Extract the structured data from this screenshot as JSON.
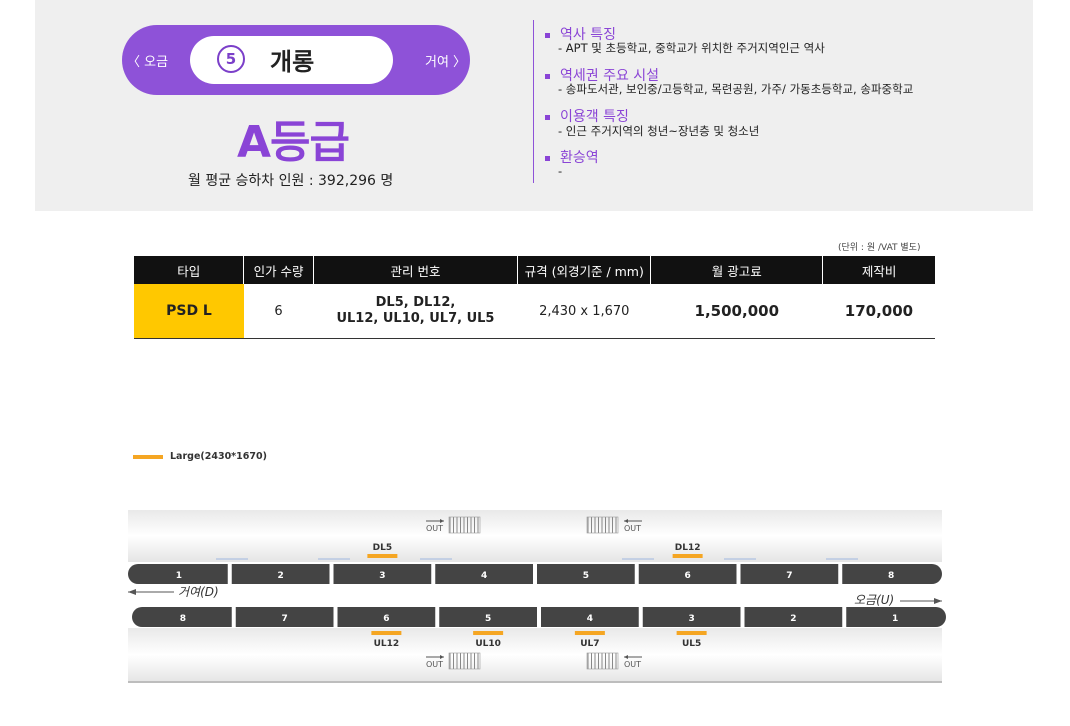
{
  "station": {
    "prev_label": "〈 오금",
    "next_label": "거여 〉",
    "line_number": "5",
    "name": "개롱",
    "grade": "A등급",
    "ridership_label": "월 평균 승하차 인원 :",
    "ridership_value": "392,296 명"
  },
  "features": [
    {
      "title": "역사 특징",
      "desc": "-  APT 및 초등학교, 중학교가 위치한 주거지역인근 역사"
    },
    {
      "title": "역세권 주요 시설",
      "desc": "-  송파도서관, 보인중/고등학교, 목련공원, 가주/ 가동초등학교, 송파중학교"
    },
    {
      "title": "이용객 특징",
      "desc": "-  인근 주거지역의 청년~장년층 및 청소년"
    },
    {
      "title": "환승역",
      "desc": "-"
    }
  ],
  "table": {
    "unit_note": "(단위 : 원 /VAT 별도)",
    "headers": [
      "타입",
      "인가 수량",
      "관리 번호",
      "규격 (외경기준 / mm)",
      "월 광고료",
      "제작비"
    ],
    "row": {
      "type": "PSD L",
      "quantity": "6",
      "mgmt_line1": "DL5, DL12,",
      "mgmt_line2": "UL12, UL10, UL7, UL5",
      "size": "2,430 x 1,670",
      "monthly_fee": "1,500,000",
      "production_fee": "170,000"
    }
  },
  "legend": {
    "label": "Large(2430*1670)",
    "color": "#f5a623"
  },
  "diagram": {
    "top_doors": [
      "1",
      "2",
      "3",
      "4",
      "5",
      "6",
      "7",
      "8"
    ],
    "bottom_doors": [
      "8",
      "7",
      "6",
      "5",
      "4",
      "3",
      "2",
      "1"
    ],
    "direction_left": "거여(D)",
    "direction_right": "오금(U)",
    "exit_label": "OUT",
    "top_ads": [
      "DL5",
      "DL12"
    ],
    "bottom_ads": [
      "UL12",
      "UL10",
      "UL7",
      "UL5"
    ]
  }
}
